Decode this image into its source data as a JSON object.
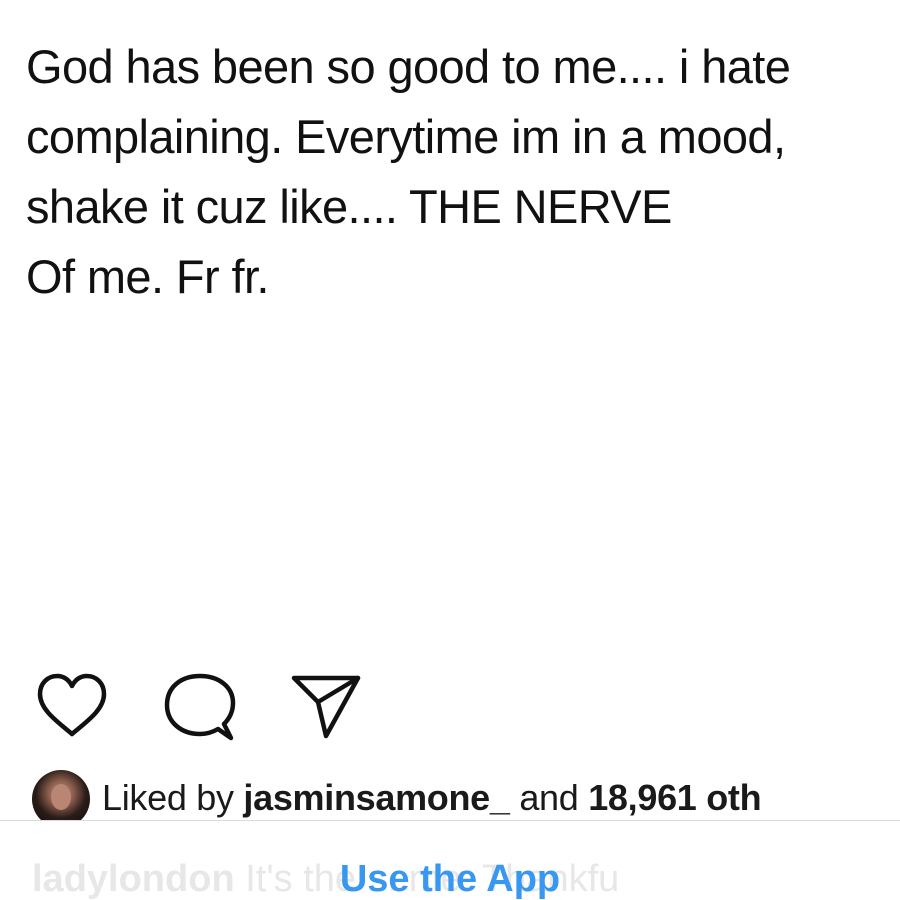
{
  "post": {
    "lines": [
      "God has been so good to me.... i hate",
      "complaining. Everytime im in a mood,",
      "shake it cuz like.... THE NERVE",
      "Of me. Fr fr."
    ]
  },
  "actions": {
    "like_icon": "heart-icon",
    "comment_icon": "speech-bubble-icon",
    "share_icon": "paper-plane-icon"
  },
  "likes": {
    "prefix": "Liked by ",
    "user": "jasminsamone_",
    "middle": " and ",
    "count": "18,961 oth"
  },
  "caption": {
    "username": "ladylondon",
    "text": " It's the ... me. Thankfu"
  },
  "banner": {
    "cta": "Use the App",
    "accent_color": "#3897f0"
  }
}
